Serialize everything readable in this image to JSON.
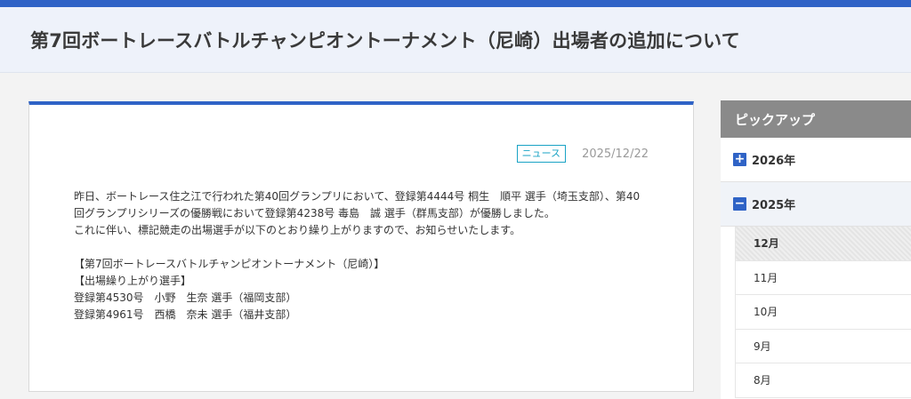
{
  "page": {
    "title": "第7回ボートレースバトルチャンピオントーナメント（尼崎）出場者の追加について"
  },
  "article": {
    "category": "ニュース",
    "date": "2025/12/22",
    "body": "昨日、ボートレース住之江で行われた第40回グランプリにおいて、登録第4444号 桐生　順平 選手（埼玉支部）、第40回グランプリシリーズの優勝戦において登録第4238号 毒島　誠 選手（群馬支部）が優勝しました。\nこれに伴い、標記競走の出場選手が以下のとおり繰り上がりますので、お知らせいたします。\n\n【第7回ボートレースバトルチャンピオントーナメント（尼崎）】\n【出場繰り上がり選手】\n登録第4530号　小野　生奈 選手（福岡支部）\n登録第4961号　西橋　奈未 選手（福井支部）"
  },
  "sidebar": {
    "header": "ピックアップ",
    "years": [
      {
        "label": "2026年",
        "icon": "plus-icon",
        "icon_char": "+"
      },
      {
        "label": "2025年",
        "icon": "minus-icon",
        "icon_char": "−"
      }
    ],
    "months": [
      {
        "label": "12月",
        "active": true
      },
      {
        "label": "11月"
      },
      {
        "label": "10月"
      },
      {
        "label": "9月"
      },
      {
        "label": "8月"
      }
    ]
  },
  "colors": {
    "accent": "#2f63c6",
    "badge": "#1aa3c5",
    "sidebar_header": "#8a8a8a"
  }
}
